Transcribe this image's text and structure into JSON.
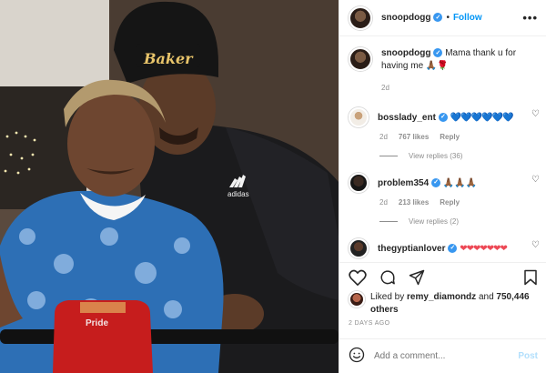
{
  "post": {
    "username": "snoopdogg",
    "follow_label": "Follow",
    "more_label": "•••",
    "caption_text": "Mama thank u for having me",
    "caption_emoji": "🙏🏾🌹",
    "caption_age": "2d"
  },
  "photo": {
    "hat_text": "Baker",
    "jacket_brand": "adidas",
    "scooter_brand": "Pride"
  },
  "comments": [
    {
      "username": "bosslady_ent",
      "text": "💙💙💙💙💙💙",
      "age": "2d",
      "likes": "767 likes",
      "reply_label": "Reply",
      "view_replies": "View replies (36)"
    },
    {
      "username": "problem354",
      "text": "🙏🏾🙏🏾🙏🏾",
      "age": "2d",
      "likes": "213 likes",
      "reply_label": "Reply",
      "view_replies": "View replies (2)"
    },
    {
      "username": "thegyptianlover",
      "text": "❤❤❤❤❤❤❤"
    }
  ],
  "likes": {
    "prefix": "Liked by",
    "user": "remy_diamondz",
    "and": "and",
    "count": "750,446 others"
  },
  "timestamp": "2 DAYS AGO",
  "add_comment": {
    "placeholder": "Add a comment...",
    "post_label": "Post"
  },
  "colors": {
    "verified": "#3897f0",
    "follow": "#0095f6",
    "muted": "#8e8e8e",
    "post_disabled": "#b2dffc"
  }
}
